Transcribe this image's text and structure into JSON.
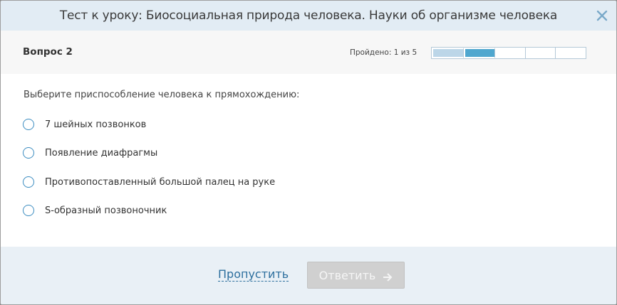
{
  "window": {
    "title": "Тест к уроку: Биосоциальная природа человека. Науки об организме человека",
    "close_icon": "close-icon"
  },
  "question_header": {
    "number_label": "Вопрос 2",
    "progress_label": "Пройдено: 1 из 5",
    "progress": {
      "total": 5,
      "passed": 1,
      "current": 2
    }
  },
  "question": {
    "text": "Выберите приспособление человека к прямохождению:",
    "options": [
      {
        "label": "7 шейных позвонков",
        "selected": false
      },
      {
        "label": "Появление диафрагмы",
        "selected": false
      },
      {
        "label": "Противопоставленный большой палец на руке",
        "selected": false
      },
      {
        "label": "S-образный позвоночник",
        "selected": false
      }
    ]
  },
  "footer": {
    "skip_label": "Пропустить",
    "answer_label": "Ответить",
    "answer_icon": "arrow-right-icon"
  },
  "colors": {
    "title_bar": "#e2ecf4",
    "accent": "#4fa7cf",
    "link": "#2d6f9e",
    "button_disabled": "#d0d0d0"
  }
}
